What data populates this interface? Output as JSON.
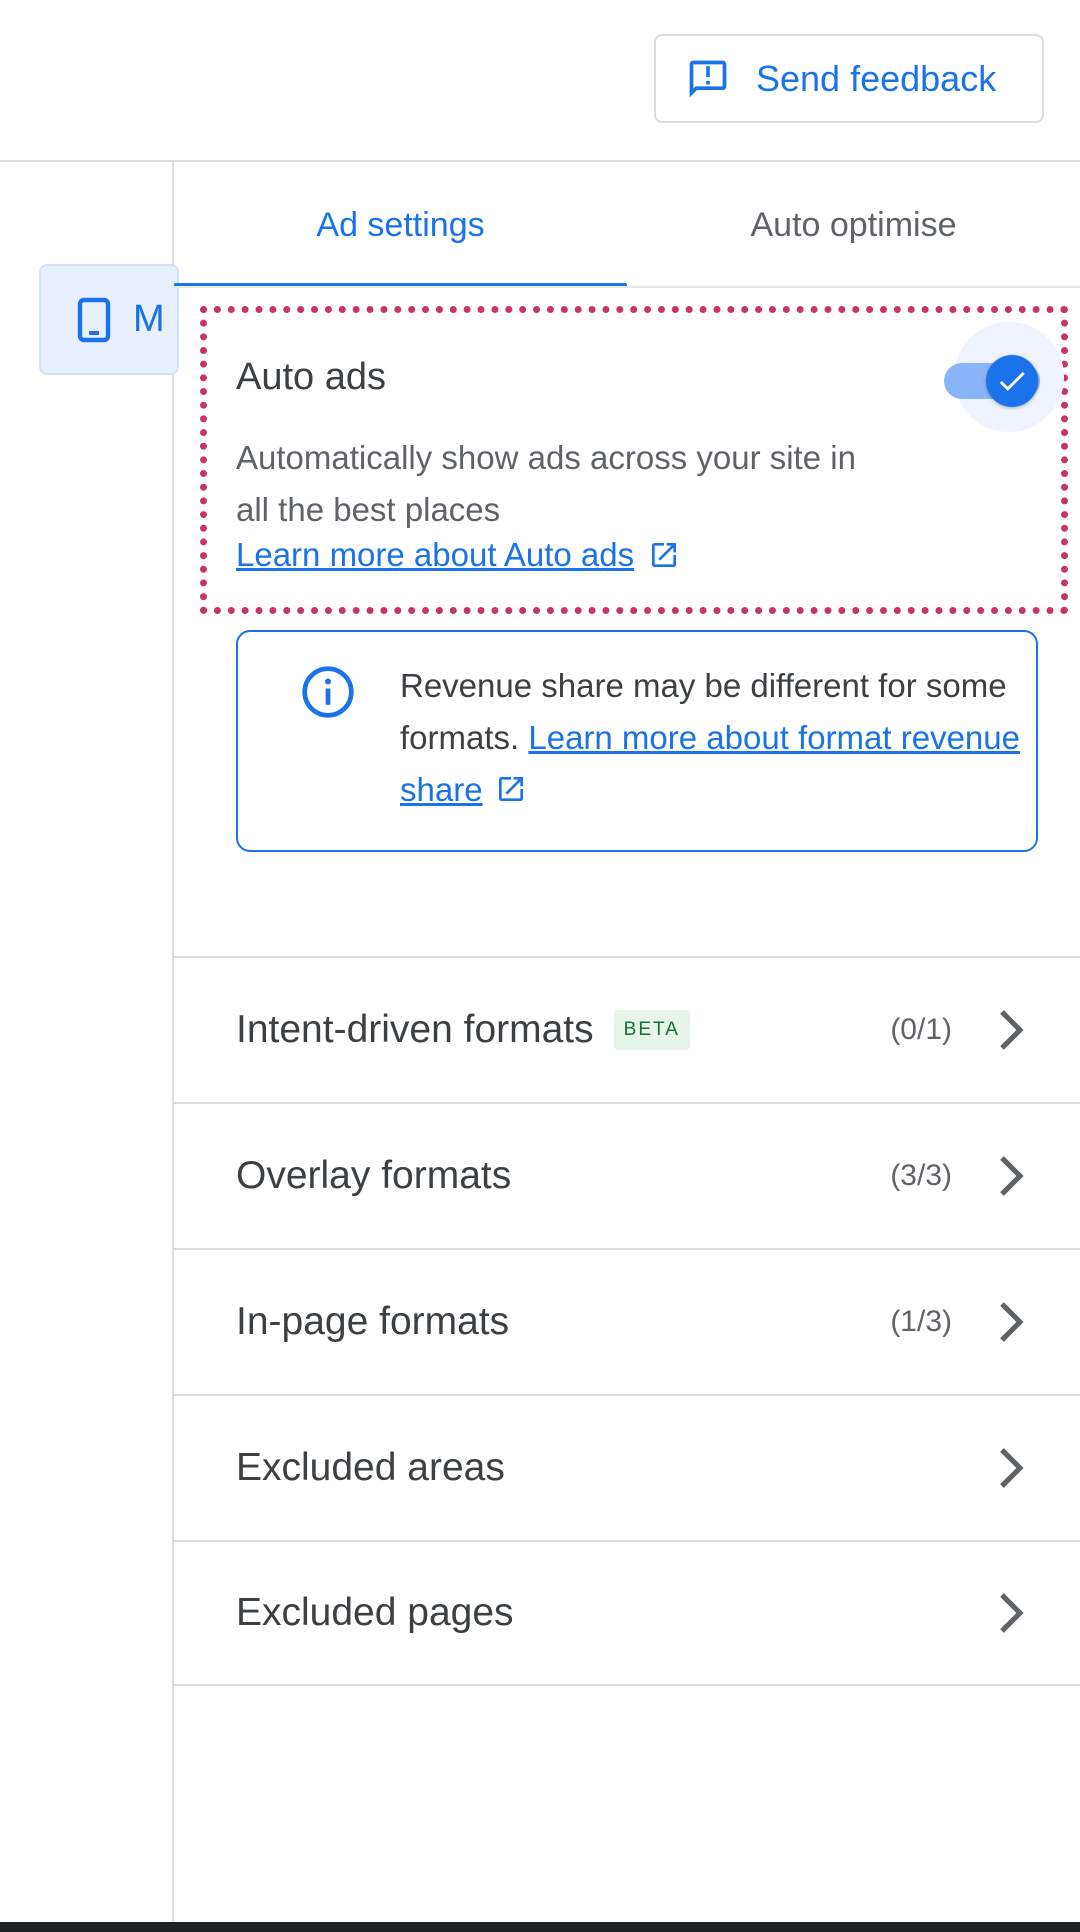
{
  "header": {
    "feedback_label": "Send feedback"
  },
  "left_rail": {
    "device_label": "M"
  },
  "tabs": [
    {
      "label": "Ad settings",
      "active": true
    },
    {
      "label": "Auto optimise",
      "active": false
    }
  ],
  "auto_ads": {
    "title": "Auto ads",
    "description": "Automatically show ads across your site in all the best places",
    "link_label": "Learn more about Auto ads",
    "enabled": true
  },
  "info": {
    "text": "Revenue share may be different for some formats. ",
    "link_label": "Learn more about format revenue share"
  },
  "formats": [
    {
      "label": "Intent-driven formats",
      "badge": "BETA",
      "count": "(0/1)"
    },
    {
      "label": "Overlay formats",
      "count": "(3/3)"
    },
    {
      "label": "In-page formats",
      "count": "(1/3)"
    },
    {
      "label": "Excluded areas"
    },
    {
      "label": "Excluded pages"
    }
  ],
  "colors": {
    "accent": "#1a73e8",
    "highlight": "#c8336a",
    "badge_bg": "#e6f4ea",
    "badge_text": "#137333"
  },
  "icons": {
    "feedback": "feedback-icon",
    "device": "smartphone-icon",
    "external": "open-in-new-icon",
    "info": "info-icon",
    "check": "check-icon",
    "chevron": "chevron-right-icon"
  }
}
